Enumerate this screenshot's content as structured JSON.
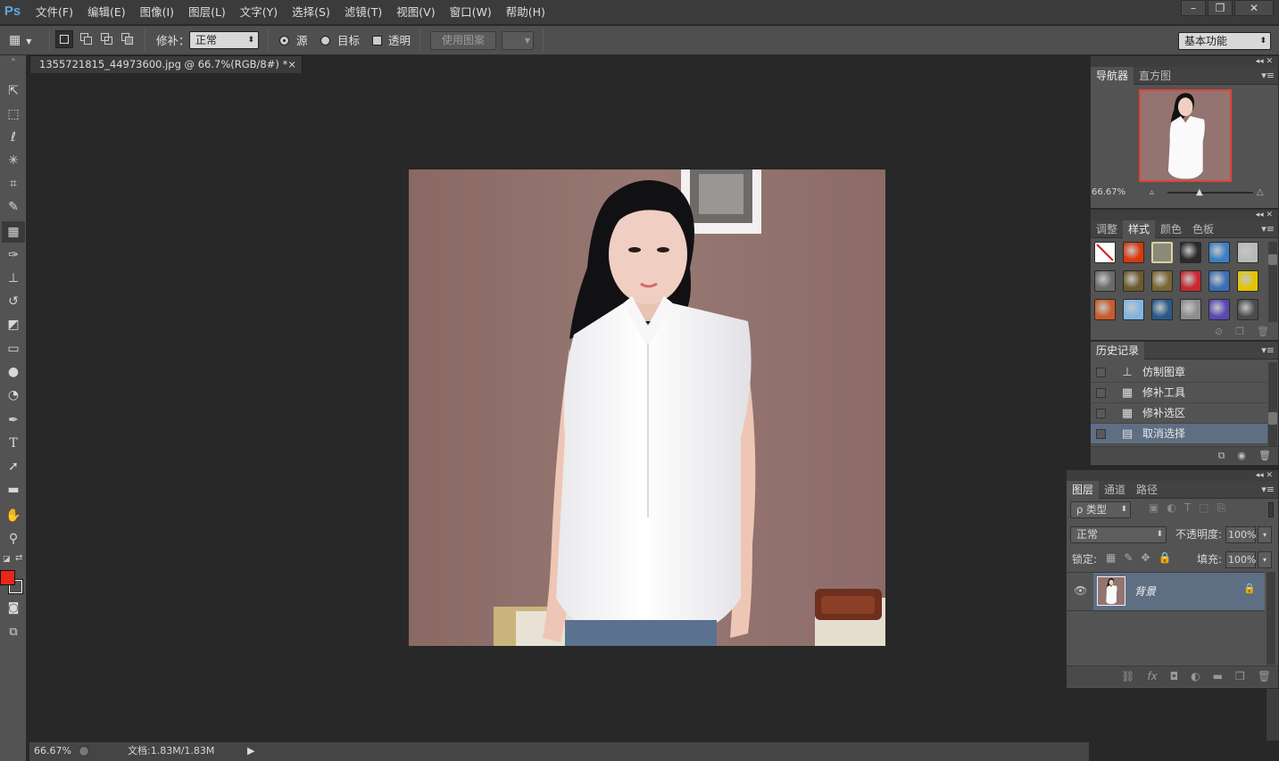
{
  "app": {
    "logo": "Ps"
  },
  "menu": [
    "文件(F)",
    "编辑(E)",
    "图像(I)",
    "图层(L)",
    "文字(Y)",
    "选择(S)",
    "滤镜(T)",
    "视图(V)",
    "窗口(W)",
    "帮助(H)"
  ],
  "window_controls": {
    "minimize": "–",
    "restore": "❐",
    "close": "✕"
  },
  "options": {
    "patch_label": "修补：",
    "patch_mode": "正常",
    "source_label": "源",
    "target_label": "目标",
    "transparent_label": "透明",
    "use_pattern_label": "使用图案",
    "workspace": "基本功能"
  },
  "document": {
    "tab_title": "1355721815_44973600.jpg @ 66.7%(RGB/8#) *",
    "close": "×"
  },
  "status": {
    "zoom": "66.67%",
    "doc_info": "文档:1.83M/1.83M"
  },
  "colors": {
    "foreground": "#e8261a",
    "background": "#ffffff",
    "accent_select": "#5e6f84"
  },
  "navigator": {
    "tabs": [
      "导航器",
      "直方图"
    ],
    "zoom": "66.67%"
  },
  "styles": {
    "tabs": [
      "调整",
      "样式",
      "颜色",
      "色板"
    ],
    "swatches": [
      [
        "#ffffff",
        "#d9380c",
        "#8a8a7a",
        "#2b2b2b",
        "#3c7fc4",
        "#b9b9b9"
      ],
      [
        "#6a6a6a",
        "#6b5a2e",
        "#7a6533",
        "#c7282f",
        "#3a6fb6",
        "#e5c400"
      ],
      [
        "#c85b2a",
        "#7fb5e3",
        "#2b5a8a",
        "#8d8d8d",
        "#5b49b0",
        "#4c4c4c"
      ]
    ]
  },
  "history": {
    "title": "历史记录",
    "items": [
      {
        "label": "仿制图章",
        "icon": "clone-stamp-icon"
      },
      {
        "label": "修补工具",
        "icon": "patch-tool-icon"
      },
      {
        "label": "修补选区",
        "icon": "patch-tool-icon"
      },
      {
        "label": "取消选择",
        "icon": "document-icon",
        "selected": true
      }
    ]
  },
  "layers": {
    "tabs": [
      "图层",
      "通道",
      "路径"
    ],
    "filter_kind": "ρ 类型",
    "blend_mode": "正常",
    "opacity_label": "不透明度:",
    "opacity": "100%",
    "lock_label": "锁定:",
    "fill_label": "填充:",
    "fill": "100%",
    "items": [
      {
        "name": "背景",
        "locked": true,
        "visible": true
      }
    ]
  }
}
